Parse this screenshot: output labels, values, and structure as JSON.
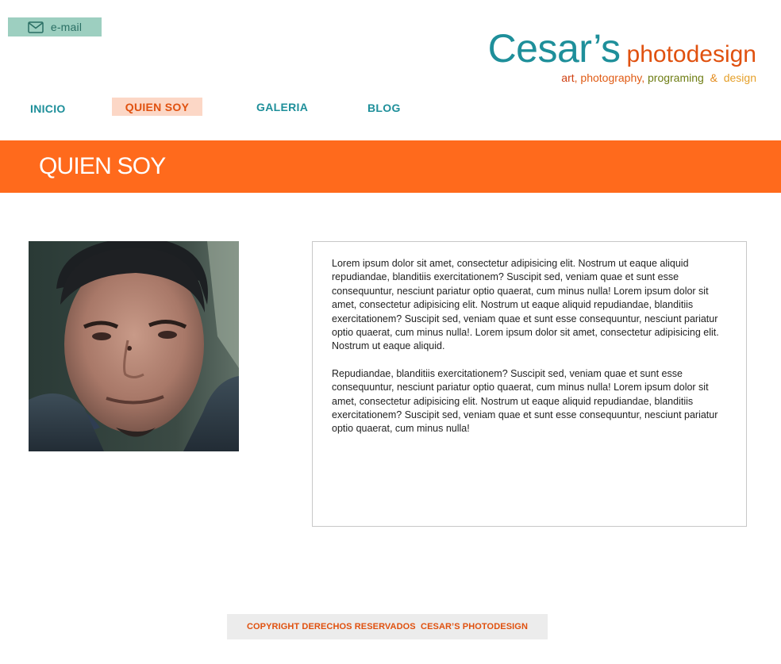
{
  "header": {
    "email_label": "e-mail",
    "email_icon": "envelope-icon",
    "logo": {
      "name_main": "Cesar’s",
      "name_sub": "photodesign",
      "tagline": {
        "art": "art",
        "comma1": ",",
        "photography": "photography",
        "comma2": ",",
        "programing": "programing",
        "amp": "&",
        "design": "design"
      }
    }
  },
  "nav": {
    "items": [
      {
        "label": "INICIO"
      },
      {
        "label": "QUIEN SOY"
      },
      {
        "label": "GALERIA"
      },
      {
        "label": "BLOG"
      }
    ]
  },
  "banner": {
    "title": "QUIEN SOY"
  },
  "content": {
    "paragraphs": [
      "Lorem ipsum dolor sit amet, consectetur adipisicing elit. Nostrum ut eaque aliquid repudiandae, blanditiis exercitationem? Suscipit sed, veniam quae et sunt esse consequuntur, nesciunt pariatur optio quaerat, cum minus nulla!  Lorem ipsum dolor sit amet, consectetur adipisicing elit. Nostrum ut eaque aliquid repudiandae, blanditiis exercitationem? Suscipit sed, veniam quae et sunt esse consequuntur, nesciunt pariatur optio quaerat, cum minus nulla!. Lorem ipsum dolor sit amet, consectetur adipisicing elit. Nostrum ut eaque aliquid.",
      "Repudiandae, blanditiis exercitationem? Suscipit sed, veniam quae et sunt esse consequuntur, nesciunt pariatur optio quaerat, cum minus nulla!  Lorem ipsum dolor sit amet, consectetur adipisicing elit. Nostrum ut eaque aliquid repudiandae, blanditiis exercitationem? Suscipit sed, veniam quae et sunt esse consequuntur, nesciunt pariatur optio quaerat, cum minus nulla!"
    ]
  },
  "footer": {
    "text": "COPYRIGHT DERECHOS RESERVADOS  CESAR’S PHOTODESIGN"
  },
  "colors": {
    "teal": "#1e8f9a",
    "orange": "#e0510f",
    "banner": "#ff6a1c",
    "email_bg": "#9dcfc0",
    "active_nav_bg": "#fcd7c6"
  }
}
